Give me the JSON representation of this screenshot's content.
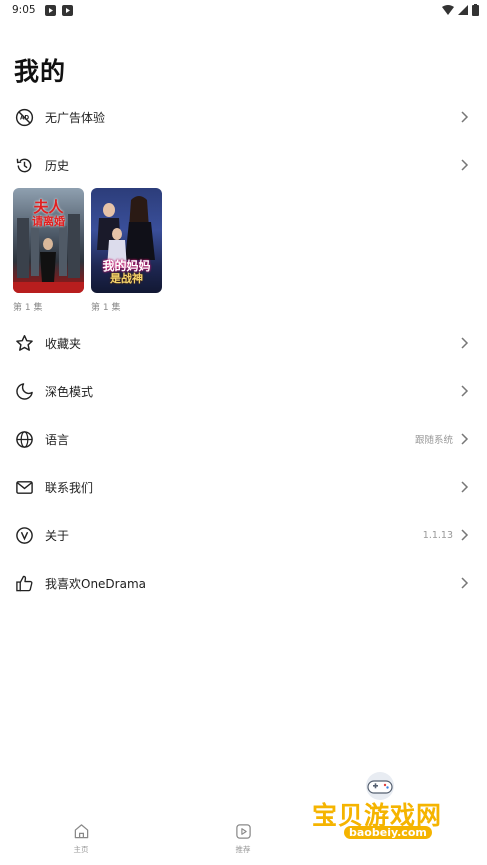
{
  "status_bar": {
    "time": "9:05"
  },
  "page": {
    "title": "我的"
  },
  "menu": {
    "no_ads": {
      "label": "无广告体验",
      "icon": "no-ads-icon"
    },
    "history": {
      "label": "历史",
      "icon": "history-icon"
    },
    "favorites": {
      "label": "收藏夹",
      "icon": "star-icon"
    },
    "dark_mode": {
      "label": "深色模式",
      "icon": "moon-icon"
    },
    "language": {
      "label": "语言",
      "value": "跟随系统",
      "icon": "globe-icon"
    },
    "contact": {
      "label": "联系我们",
      "icon": "mail-icon"
    },
    "about": {
      "label": "关于",
      "value": "1.1.13",
      "icon": "version-icon"
    },
    "like": {
      "label": "我喜欢OneDrama",
      "icon": "thumbs-up-icon"
    }
  },
  "history_items": [
    {
      "cover_title_line1": "夫人",
      "cover_title_line2": "请离婚",
      "episode": "第 1 集"
    },
    {
      "cover_title_line1": "我的妈妈",
      "cover_title_line2": "是战神",
      "episode": "第 1 集"
    }
  ],
  "bottom_nav": {
    "home": {
      "label": "主页",
      "icon": "home-icon"
    },
    "recommend": {
      "label": "推荐",
      "icon": "play-icon"
    }
  },
  "watermark": {
    "text": "宝贝游戏网",
    "url": "baobeiy.com"
  },
  "colors": {
    "accent_watermark": "#f5b400",
    "text_primary": "#1e1e1e",
    "text_secondary": "#999999"
  }
}
